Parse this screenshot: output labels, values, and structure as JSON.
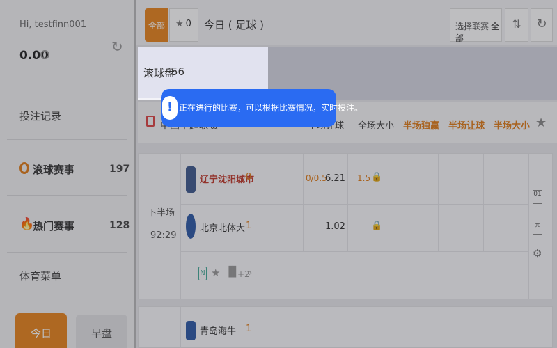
{
  "sidebar": {
    "greeting": "Hi, testfinn001",
    "balance": "0.00",
    "bet_records": "投注记录",
    "items": [
      {
        "label": "滚球赛事",
        "count": "197"
      },
      {
        "label": "热门赛事",
        "count": "128"
      }
    ],
    "sports_menu": "体育菜单",
    "tabs": {
      "today": "今日",
      "early": "早盘"
    }
  },
  "topbar": {
    "all_tab": "全部",
    "fav_count": "0",
    "title": "今日 ( 足球 )",
    "select_league_label": "选择联赛",
    "select_league_value": "全部"
  },
  "banner": {
    "label": "滚球盘",
    "count": "56"
  },
  "tooltip": {
    "text": "正在进行的比赛，可以根据比赛情况，实时投注。"
  },
  "table": {
    "headers": [
      "全场大小",
      "半场独赢",
      "半场让球",
      "半场大小"
    ],
    "col_full_handicap": "全场让球",
    "left_header": "中国中超联赛"
  },
  "match": {
    "period": "下半场",
    "time": "92:29",
    "home": {
      "name": "辽宁沈阳城市",
      "score": "0"
    },
    "away": {
      "name": "北京北体大",
      "score": "1"
    },
    "handicap_line": "0/0.5",
    "home_handicap_odds": "6.21",
    "ou_line": "1.5",
    "away_handicap_odds": "1.02",
    "more_markets": "+2",
    "side_labels": [
      "01",
      "四"
    ]
  },
  "match2": {
    "home": {
      "name": "青岛海牛",
      "score": "1"
    }
  },
  "colors": {
    "accent": "#e07b18",
    "tooltip": "#2a6bf2",
    "home_team": "#c0392b"
  }
}
